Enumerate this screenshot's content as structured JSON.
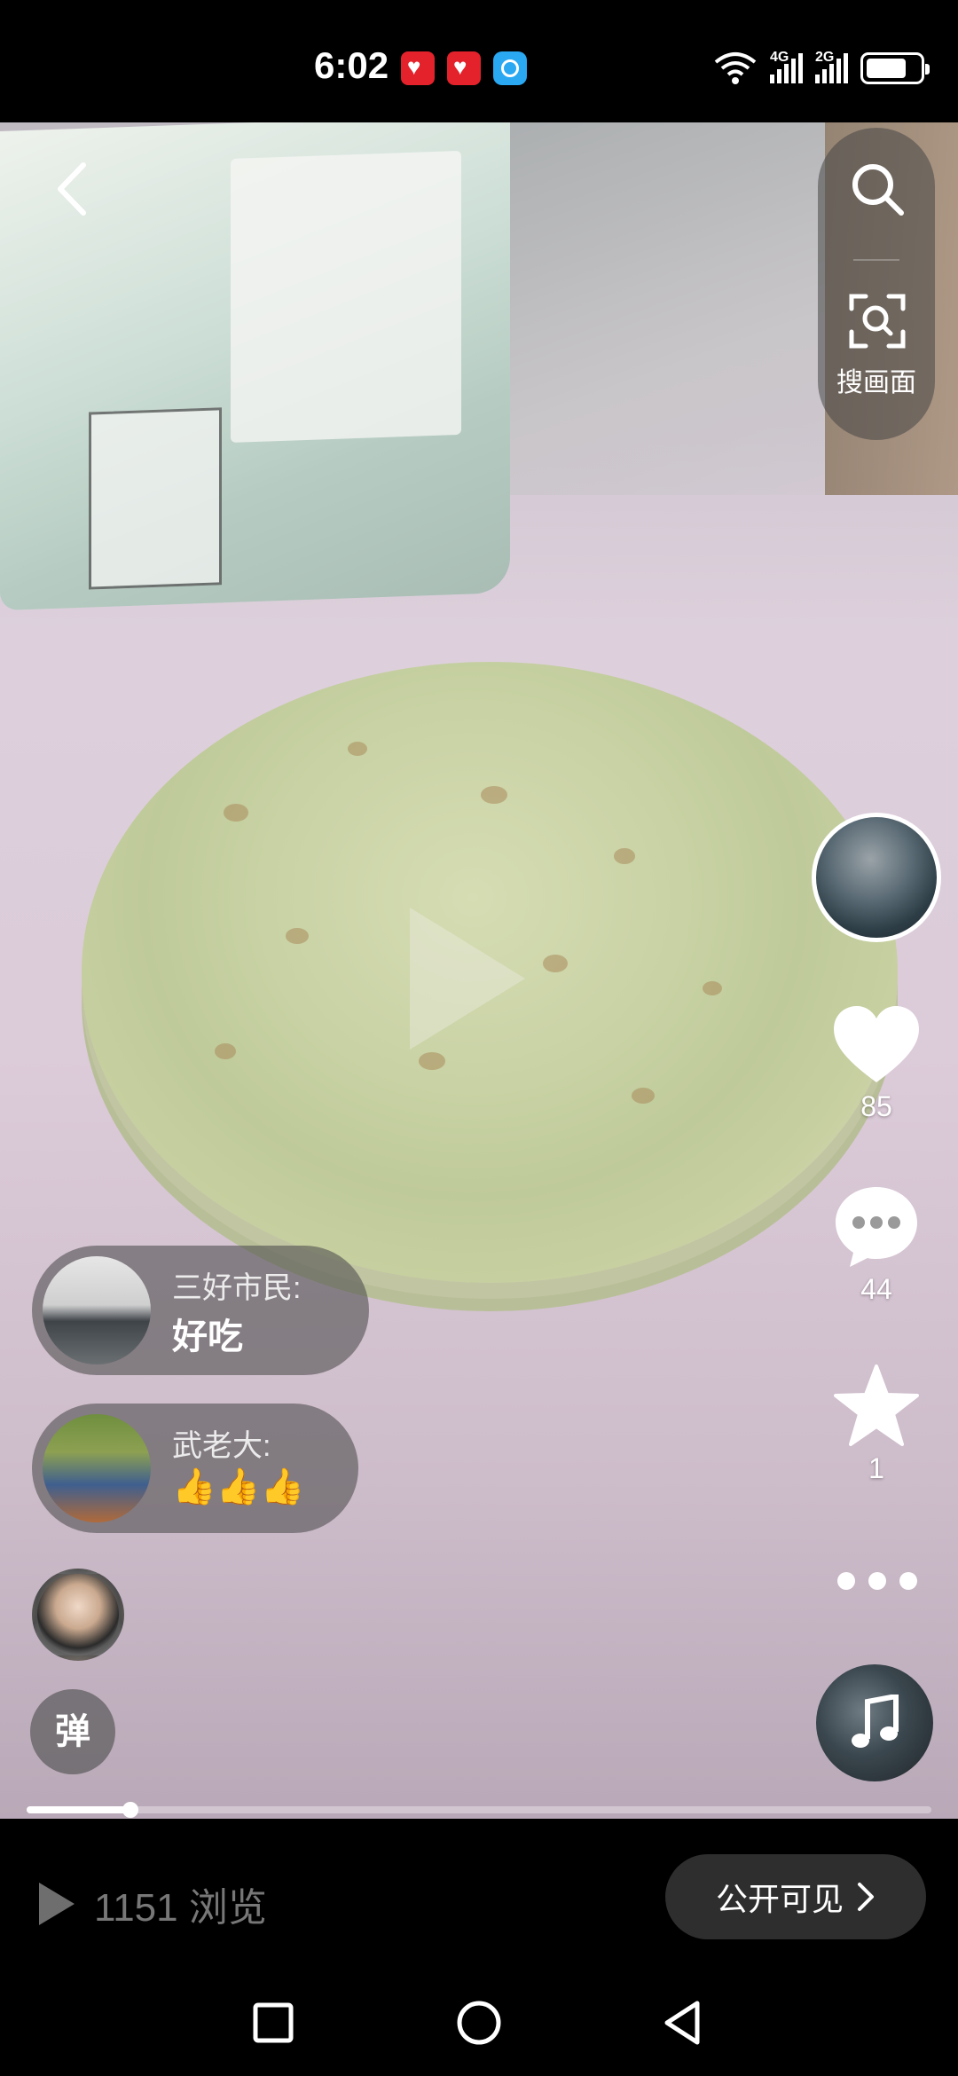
{
  "status_bar": {
    "time": "6:02",
    "network_1": "4G",
    "network_2": "2G"
  },
  "search": {
    "scan_label": "搜画面"
  },
  "actions": {
    "likes": "85",
    "comments": "44",
    "favorites": "1"
  },
  "comments": [
    {
      "user": "三好市民:",
      "text": "好吃"
    },
    {
      "user": "武老大:",
      "text": "👍👍👍"
    }
  ],
  "danmu_label": "弹",
  "progress_fraction": 0.115,
  "bottom_bar": {
    "views": "1151 浏览",
    "visibility": "公开可见"
  },
  "icons": [
    "back-arrow-icon",
    "search-icon",
    "scan-icon",
    "heart-icon",
    "comment-icon",
    "star-icon",
    "more-icon",
    "music-note-icon",
    "play-icon",
    "chevron-right-icon",
    "nav-recents-icon",
    "nav-home-icon",
    "nav-back-icon"
  ],
  "colors": {
    "background": "#000000",
    "pill": "#2e2e2e",
    "views_text": "#777777"
  }
}
